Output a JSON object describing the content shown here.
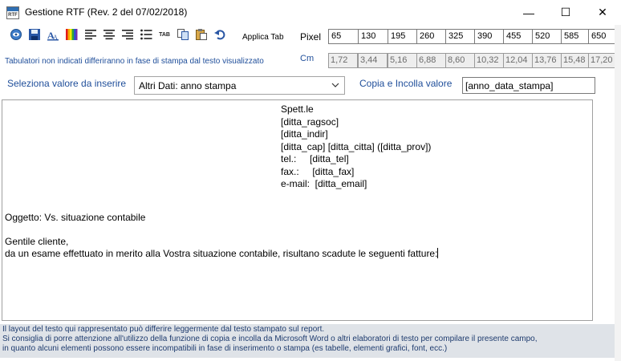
{
  "window": {
    "title": "Gestione RTF (Rev. 2 del 07/02/2018)",
    "app_icon_text": "RTF",
    "minimize_glyph": "—",
    "maximize_glyph": "☐",
    "close_glyph": "✕"
  },
  "toolbar": {
    "icons": [
      "preview-icon",
      "save-icon",
      "font-icon",
      "color-icon",
      "align-left-icon",
      "align-center-icon",
      "align-right-icon",
      "bullet-list-icon",
      "tab-icon",
      "copy-icon",
      "paste-icon",
      "undo-icon"
    ],
    "tab_icon_text": "TAB",
    "apply_tab_label": "Applica Tab",
    "pixel_label": "Pixel",
    "pixel_values": [
      "65",
      "130",
      "195",
      "260",
      "325",
      "390",
      "455",
      "520",
      "585",
      "650"
    ]
  },
  "tabs_row": {
    "note": "Tabulatori non indicati differiranno in fase di stampa dal testo visualizzato",
    "cm_label": "Cm",
    "cm_values": [
      "1,72",
      "3,44",
      "5,16",
      "6,88",
      "8,60",
      "10,32",
      "12,04",
      "13,76",
      "15,48",
      "17,20"
    ]
  },
  "insert_row": {
    "select_label": "Seleziona valore da inserire",
    "select_value": "Altri Dati: anno stampa",
    "copy_label": "Copia e Incolla valore",
    "copy_value": "[anno_data_stampa]"
  },
  "editor": {
    "address_lines": [
      "Spett.le",
      "[ditta_ragsoc]",
      "[ditta_indir]",
      "[ditta_cap] [ditta_citta] ([ditta_prov])",
      "tel.:     [ditta_tel]",
      "fax.:     [ditta_fax]",
      "e-mail:  [ditta_email]"
    ],
    "body_lines": [
      "Oggetto: Vs. situazione contabile",
      "",
      "Gentile cliente,",
      "da un esame effettuato in merito alla Vostra situazione contabile, risultano scadute le seguenti fatture:"
    ]
  },
  "footer": {
    "line1": "Il layout del testo qui rappresentato può differire leggermente dal testo stampato sul report.",
    "line2": "Si consiglia di porre attenzione all'utilizzo della funzione di copia e incolla da Microsoft Word o altri elaboratori di testo per compilare il presente campo,",
    "line3": "in quanto alcuni elementi possono essere incompatibili in fase di inserimento o stampa (es tabelle, elementi grafici, font, ecc.)"
  },
  "colors": {
    "label_blue": "#1f4e9a",
    "footer_bg": "#dfe3e8"
  }
}
